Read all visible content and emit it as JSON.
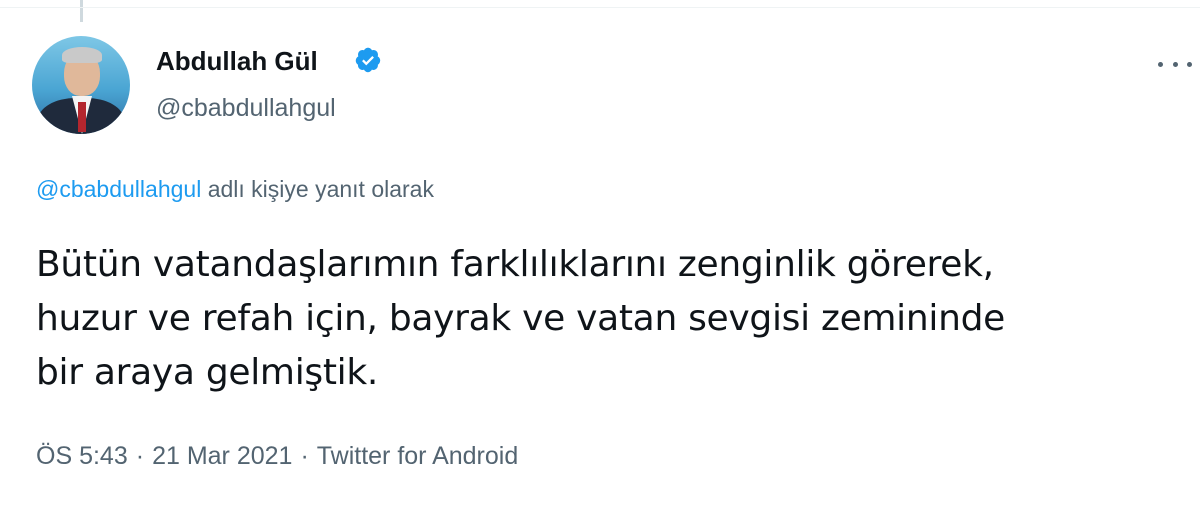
{
  "tweet": {
    "author": {
      "name": "Abdullah Gül",
      "handle": "@cbabdullahgul",
      "verified": true
    },
    "reply": {
      "handle": "@cbabdullahgul",
      "suffix": " adlı kişiye yanıt olarak"
    },
    "text": "Bütün vatandaşlarımın farklılıklarını zenginlik görerek,\nhuzur ve refah için, bayrak ve vatan sevgisi zemininde\nbir araya gelmiştik.",
    "time": "ÖS 5:43",
    "separator": "·",
    "date": "21 Mar 2021",
    "source": "Twitter for Android"
  },
  "icons": {
    "verified": "verified-badge-icon",
    "more": "more-options-icon"
  },
  "colors": {
    "accent": "#1d9bf0",
    "secondary_text": "#536471",
    "primary_text": "#0f1419"
  }
}
